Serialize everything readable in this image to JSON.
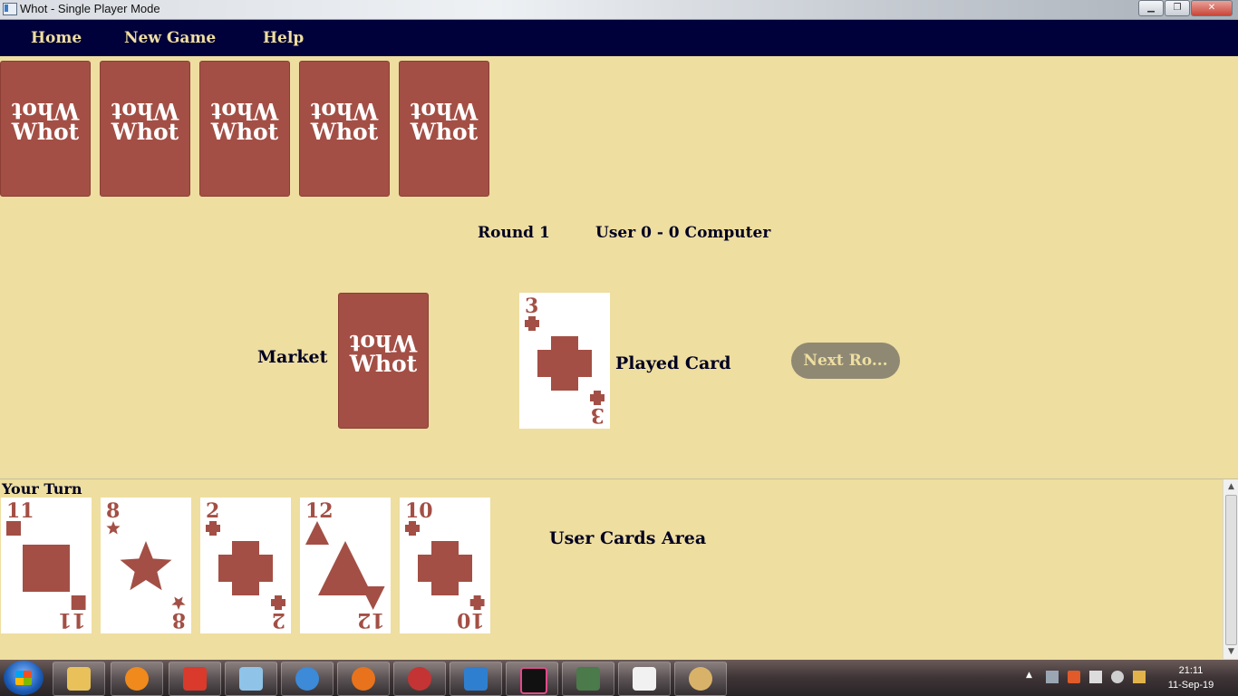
{
  "window": {
    "title": "Whot - Single Player Mode",
    "minimize": "▁",
    "maximize": "❐",
    "close": "✕"
  },
  "menu": {
    "home": "Home",
    "new_game": "New Game",
    "help": "Help"
  },
  "card_back": {
    "logo": "Whot"
  },
  "computer_hand": {
    "count": 5
  },
  "status": {
    "round": "Round 1",
    "score": "User 0 - 0 Computer"
  },
  "market": {
    "label": "Market"
  },
  "played": {
    "label": "Played Card",
    "number": "3",
    "shape": "cross"
  },
  "next_round": {
    "label": "Next Ro..."
  },
  "user": {
    "turn_label": "Your Turn",
    "area_label": "User Cards Area",
    "cards": [
      {
        "number": "11",
        "shape": "square"
      },
      {
        "number": "8",
        "shape": "star"
      },
      {
        "number": "2",
        "shape": "cross"
      },
      {
        "number": "12",
        "shape": "triangle"
      },
      {
        "number": "10",
        "shape": "cross"
      }
    ]
  },
  "clock": {
    "time": "21:11",
    "date": "11-Sep-19"
  },
  "colors": {
    "background": "#EEDEA0",
    "menu": "#00003A",
    "card_red": "#A34F45",
    "button": "#8F8974"
  }
}
